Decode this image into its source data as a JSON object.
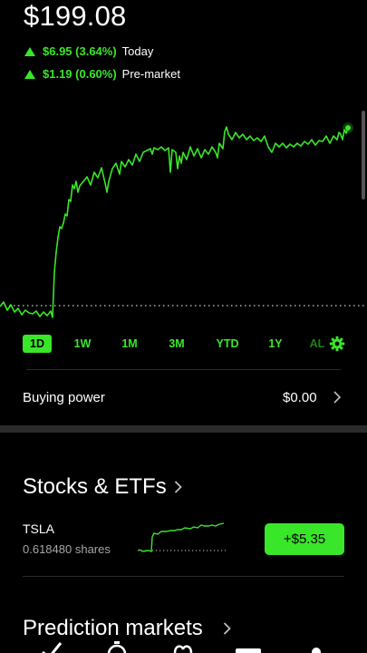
{
  "quote": {
    "price": "$199.08",
    "today_change": "$6.95 (3.64%)",
    "today_label": "Today",
    "premarket_change": "$1.19 (0.60%)",
    "premarket_label": "Pre-market"
  },
  "colors": {
    "accent": "#39e629",
    "background": "#000000",
    "secondary_text": "#a6a6a6"
  },
  "ranges": [
    {
      "label": "1D",
      "active": true
    },
    {
      "label": "1W",
      "active": false
    },
    {
      "label": "1M",
      "active": false
    },
    {
      "label": "3M",
      "active": false
    },
    {
      "label": "YTD",
      "active": false
    },
    {
      "label": "1Y",
      "active": false
    },
    {
      "label": "AL",
      "active": false
    }
  ],
  "buying_power": {
    "label": "Buying power",
    "value": "$0.00"
  },
  "stocks": {
    "title": "Stocks & ETFs",
    "items": [
      {
        "symbol": "TSLA",
        "shares": "0.618480 shares",
        "change": "+$5.35"
      }
    ]
  },
  "prediction": {
    "title": "Prediction markets"
  },
  "nav_icons": [
    "check-icon",
    "clock-icon",
    "gift-icon",
    "card-icon",
    "person-icon"
  ]
}
